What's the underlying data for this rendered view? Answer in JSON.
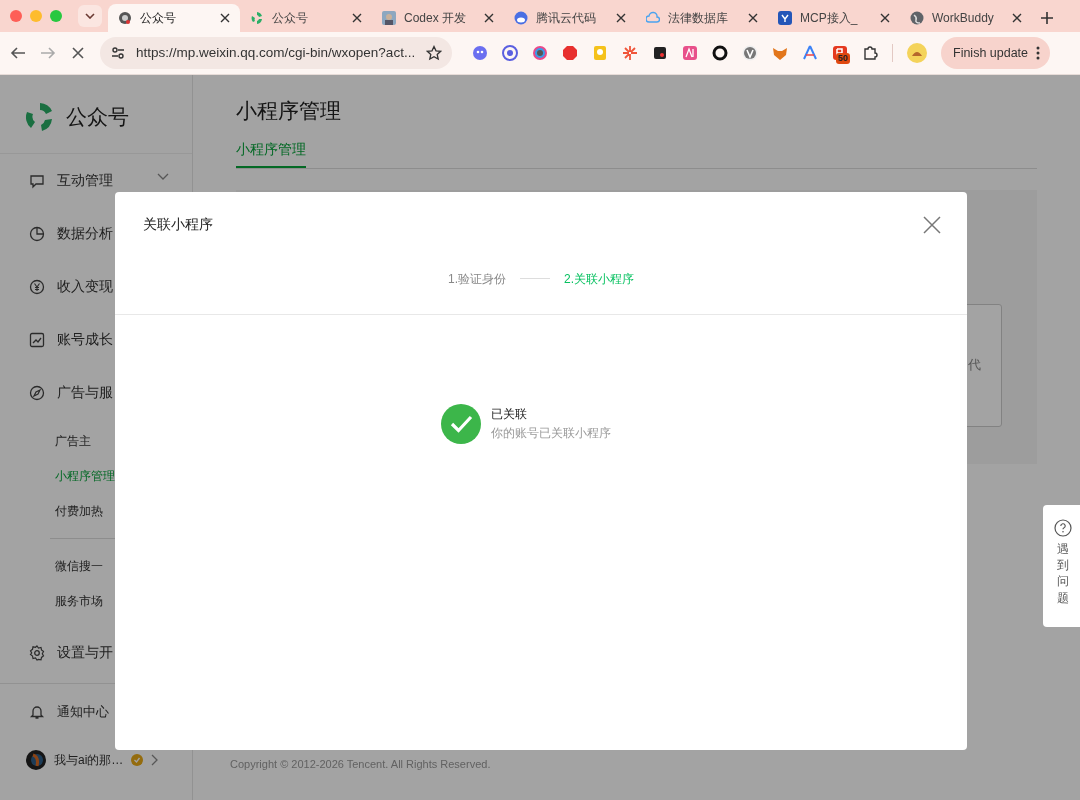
{
  "browser": {
    "tabs": [
      {
        "title": "公众号",
        "selected": true
      },
      {
        "title": "公众号",
        "selected": false
      },
      {
        "title": "Codex 开发",
        "selected": false
      },
      {
        "title": "腾讯云代码",
        "selected": false
      },
      {
        "title": "法律数据库",
        "selected": false
      },
      {
        "title": "MCP接入_",
        "selected": false
      },
      {
        "title": "WorkBuddy",
        "selected": false
      }
    ],
    "url": "https://mp.weixin.qq.com/cgi-bin/wxopen?act...",
    "extension_badge": "50",
    "update_button": "Finish update"
  },
  "sidebar": {
    "logo": "公众号",
    "sections": [
      {
        "label": "互动管理",
        "kind": "group"
      },
      {
        "label": "数据分析",
        "kind": "section"
      },
      {
        "label": "收入变现",
        "kind": "section"
      },
      {
        "label": "账号成长",
        "kind": "section"
      },
      {
        "label": "广告与服",
        "kind": "section",
        "children_groups": [
          [
            {
              "label": "广告主",
              "selected": false
            },
            {
              "label": "小程序管理",
              "selected": true
            },
            {
              "label": "付费加热",
              "selected": false
            }
          ],
          [
            {
              "label": "微信搜一",
              "selected": false
            },
            {
              "label": "服务市场",
              "selected": false
            }
          ]
        ]
      },
      {
        "label": "设置与开",
        "kind": "section"
      }
    ],
    "notifications": "通知中心",
    "account": "我与ai的那…"
  },
  "page": {
    "title": "小程序管理",
    "tabs": [
      {
        "label": "小程序管理",
        "selected": true
      }
    ],
    "card_text": "代",
    "copyright": "Copyright © 2012-2026 Tencent. All Rights Reserved."
  },
  "modal": {
    "title": "关联小程序",
    "steps": [
      {
        "label": "1.验证身份",
        "selected": false
      },
      {
        "label": "2.关联小程序",
        "selected": true
      }
    ],
    "result_title": "已关联",
    "result_text": "你的账号已关联小程序"
  },
  "help": "遇到问题"
}
